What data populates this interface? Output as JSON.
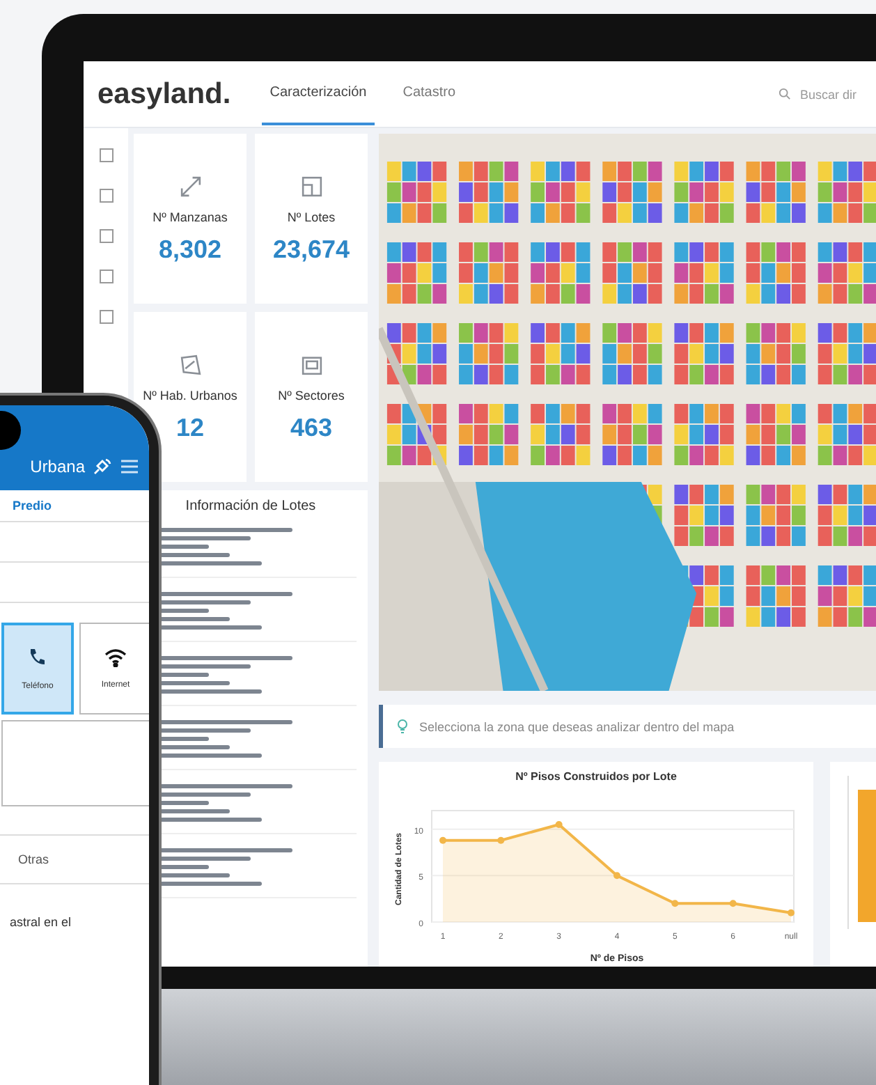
{
  "app": {
    "logo": "easyland.",
    "tabs": [
      {
        "label": "Caracterización",
        "selected": true
      },
      {
        "label": "Catastro",
        "selected": false
      }
    ],
    "search": {
      "placeholder": "Buscar dir"
    }
  },
  "stats": [
    {
      "label": "Nº Manzanas",
      "value": "8,302"
    },
    {
      "label": "Nº Lotes",
      "value": "23,674"
    },
    {
      "label": "Nº Hab. Urbanos",
      "value": "12"
    },
    {
      "label": "Nº Sectores",
      "value": "463"
    }
  ],
  "lot_info": {
    "title": "Información de Lotes",
    "entries": [
      {
        "kind": "record"
      },
      {
        "kind": "record"
      },
      {
        "kind": "record"
      },
      {
        "kind": "record"
      },
      {
        "kind": "record"
      },
      {
        "kind": "record"
      }
    ]
  },
  "hint": "Selecciona la zona que deseas analizar dentro del mapa",
  "chart": {
    "chart_data": {
      "type": "area",
      "title": "Nº Pisos Construidos por Lote",
      "xlabel": "Nº de Pisos",
      "ylabel": "Cantidad de Lotes",
      "categories": [
        "1",
        "2",
        "3",
        "4",
        "5",
        "6",
        "null"
      ],
      "series": [
        {
          "color": "#f2b649",
          "marker": "o",
          "values": [
            8.8,
            8.8,
            10.5,
            5,
            2,
            2,
            1
          ]
        }
      ],
      "ylim": [
        0,
        12
      ],
      "yticks": [
        0,
        5,
        10
      ]
    }
  },
  "phone": {
    "title": "Urbana",
    "tab": "Predio",
    "tiles": [
      {
        "label": "Teléfono",
        "selected": true
      },
      {
        "label": "Internet",
        "selected": false
      }
    ],
    "option": "Otras",
    "note": "astral en el"
  }
}
